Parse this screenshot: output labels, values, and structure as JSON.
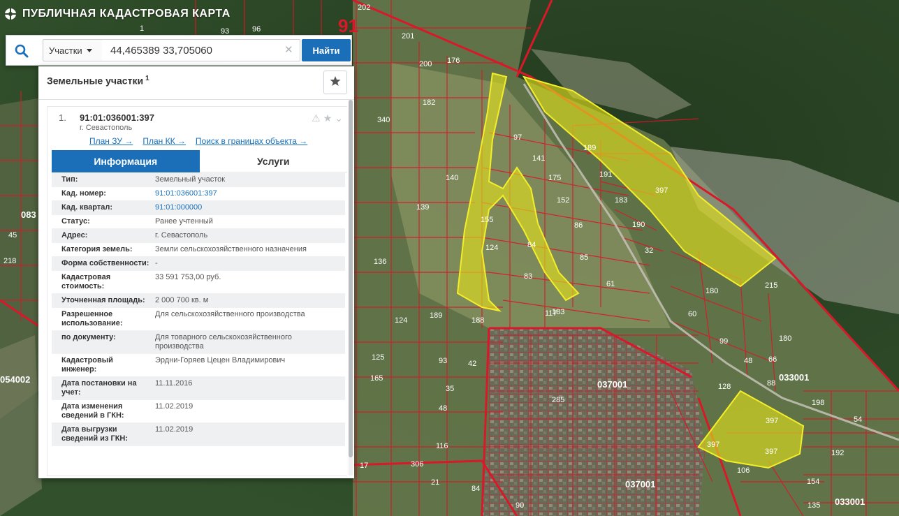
{
  "app": {
    "title": "ПУБЛИЧНАЯ КАДАСТРОВАЯ КАРТА"
  },
  "search": {
    "type_selected": "Участки",
    "query": "44,465389 33,705060",
    "button_label": "Найти"
  },
  "results": {
    "title": "Земельные участки",
    "count": "1",
    "item": {
      "index": "1.",
      "cad_number": "91:01:036001:397",
      "city": "г. Севастополь",
      "links": [
        "План ЗУ →",
        "План КК →",
        "Поиск в границах объекта →"
      ]
    },
    "tabs": [
      "Информация",
      "Услуги"
    ],
    "attributes": [
      {
        "label": "Тип:",
        "value": "Земельный участок"
      },
      {
        "label": "Кад. номер:",
        "value": "91:01:036001:397"
      },
      {
        "label": "Кад. квартал:",
        "value": "91:01:000000"
      },
      {
        "label": "Статус:",
        "value": "Ранее учтенный"
      },
      {
        "label": "Адрес:",
        "value": "г. Севастополь"
      },
      {
        "label": "Категория земель:",
        "value": "Земли сельскохозяйственного назначения"
      },
      {
        "label": "Форма собственности:",
        "value": "-"
      },
      {
        "label": "Кадастровая стоимость:",
        "value": "33 591 753,00 руб."
      },
      {
        "label": "Уточненная площадь:",
        "value": "2 000 700 кв. м"
      },
      {
        "label": "Разрешенное использование:",
        "value": "Для сельскохозяйственного производства"
      },
      {
        "label": "по документу:",
        "value": "Для товарного сельскохозяйственного производства"
      },
      {
        "label": "Кадастровый инженер:",
        "value": "Эрдни-Горяев Цецен Владимирович"
      },
      {
        "label": "Дата постановки на учет:",
        "value": "11.11.2016"
      },
      {
        "label": "Дата изменения сведений в ГКН:",
        "value": "11.02.2019"
      },
      {
        "label": "Дата выгрузки сведений из ГКН:",
        "value": "11.02.2019"
      }
    ]
  },
  "map": {
    "big_label": "91",
    "quarter_labels": [
      "037001",
      "033001",
      "037001",
      "033001",
      "054002",
      "083"
    ],
    "plot_labels": [
      "202",
      "201",
      "200",
      "176",
      "182",
      "340",
      "97",
      "141",
      "175",
      "152",
      "86",
      "85",
      "189",
      "191",
      "183",
      "190",
      "32",
      "397",
      "215",
      "180",
      "60",
      "99",
      "48",
      "66",
      "180",
      "88",
      "128",
      "198",
      "54",
      "192",
      "124",
      "155",
      "140",
      "139",
      "136",
      "124",
      "84",
      "83",
      "183",
      "93",
      "61",
      "117",
      "188",
      "189",
      "42",
      "35",
      "125",
      "165",
      "48",
      "116",
      "306",
      "21",
      "17",
      "84",
      "90",
      "285",
      "397",
      "397",
      "397",
      "154",
      "135",
      "106",
      "93",
      "96",
      "1",
      "218",
      "45"
    ],
    "colors": {
      "boundary": "#d9182a",
      "highlight": "#e4e21a"
    }
  }
}
